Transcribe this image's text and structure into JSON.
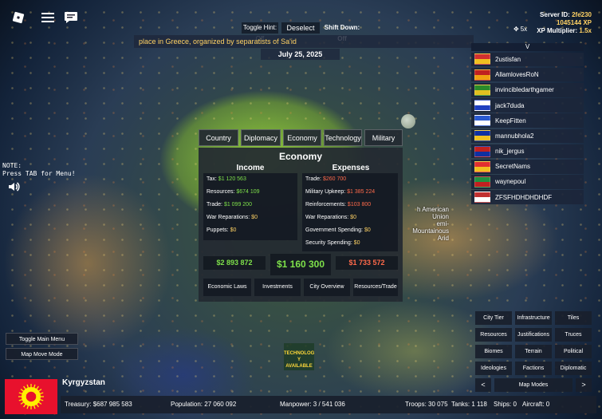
{
  "hud": {
    "toggle_hint": "Toggle Hint: Off",
    "deselect": "Deselect",
    "shift_down": "Shift Down: Off",
    "ticker": "place in Greece, organized by separatists of Sa'id",
    "date": "July 25, 2025",
    "zoom": "5x"
  },
  "server": {
    "id_label": "Server ID:",
    "id_value": "2fe230",
    "xp": "1045144 XP",
    "multiplier_label": "XP Multiplier:",
    "multiplier_value": "1.5x"
  },
  "players": {
    "header": "V",
    "list": [
      {
        "name": "2ustisfan",
        "flag": [
          "#d03030",
          "#f0c020"
        ]
      },
      {
        "name": "AllamlovesRoN",
        "flag": [
          "#c02020",
          "#f0a010"
        ]
      },
      {
        "name": "invincibledarthgamer",
        "flag": [
          "#2a8a2a",
          "#e0c020"
        ]
      },
      {
        "name": "jack7duda",
        "flag": [
          "#ffffff",
          "#2040c0"
        ]
      },
      {
        "name": "KeepFitten",
        "flag": [
          "#2a5ad0",
          "#ffffff"
        ]
      },
      {
        "name": "mannubhola2",
        "flag": [
          "#1030a0",
          "#f0c020"
        ]
      },
      {
        "name": "nik_jergus",
        "flag": [
          "#c02020",
          "#1030a0"
        ]
      },
      {
        "name": "SecretNams",
        "flag": [
          "#e03030",
          "#f0c020"
        ]
      },
      {
        "name": "waynepoul",
        "flag": [
          "#209040",
          "#c02020"
        ]
      },
      {
        "name": "ZFSFHDHDHDHDF",
        "flag": [
          "#c03030",
          "#ffffff"
        ]
      }
    ]
  },
  "left": {
    "note_line1": "NOTE:",
    "note_line2": "Press TAB for Menu!",
    "toggle_menu": "Toggle Main Menu",
    "map_move_mode": "Map Move Mode"
  },
  "map_labels": {
    "union_1": "h American Union",
    "union_2": "emi-Mountainous",
    "union_3": "Arid",
    "tech_1": "TECHNOLOG",
    "tech_2": "Y AVAILABLE"
  },
  "tabs": [
    "Country",
    "Diplomacy",
    "Economy",
    "Technology",
    "Military"
  ],
  "economy": {
    "title": "Economy",
    "income_header": "Income",
    "expenses_header": "Expenses",
    "income": [
      {
        "label": "Tax:",
        "value": "$1 120 563",
        "tone": "g"
      },
      {
        "label": "Resources:",
        "value": "$674 109",
        "tone": "g"
      },
      {
        "label": "Trade:",
        "value": "$1 099 200",
        "tone": "g"
      },
      {
        "label": "War Reparations:",
        "value": "$0",
        "tone": "y"
      },
      {
        "label": "Puppets:",
        "value": "$0",
        "tone": "y"
      }
    ],
    "expenses": [
      {
        "label": "Trade:",
        "value": "$260 700",
        "tone": "r"
      },
      {
        "label": "Military Upkeep:",
        "value": "$1 385 224",
        "tone": "r"
      },
      {
        "label": "Reinforcements:",
        "value": "$103 800",
        "tone": "r"
      },
      {
        "label": "War Reparations:",
        "value": "$0",
        "tone": "y"
      },
      {
        "label": "Government Spending:",
        "value": "$0",
        "tone": "y"
      },
      {
        "label": "Security Spending:",
        "value": "$0",
        "tone": "y"
      }
    ],
    "income_total": "$2 893 872",
    "net_total": "$1 160 300",
    "expense_total": "$1 733 572",
    "buttons": [
      "Economic Laws",
      "Investments",
      "City Overview",
      "Resources/Trade"
    ]
  },
  "map_modes": {
    "buttons": [
      "City Tier",
      "Infrastructure",
      "Tiles",
      "Resources",
      "Justifications",
      "Truces",
      "Biomes",
      "Terrain",
      "Political",
      "Ideologies",
      "Factions",
      "Diplomatic"
    ],
    "prev": "<",
    "label": "Map Modes",
    "next": ">"
  },
  "country": {
    "name": "Kyrgyzstan",
    "flag_color": "#e8112d",
    "sun_color": "#ffef00"
  },
  "stats": {
    "treasury": "Treasury:  $687 985 583",
    "population": "Population: 27 060 092",
    "manpower": "Manpower:  3  /  541 036",
    "troops": "Troops: 30 075",
    "tanks": "Tanks: 1 118",
    "ships": "Ships: 0",
    "aircraft": "Aircraft: 0"
  }
}
